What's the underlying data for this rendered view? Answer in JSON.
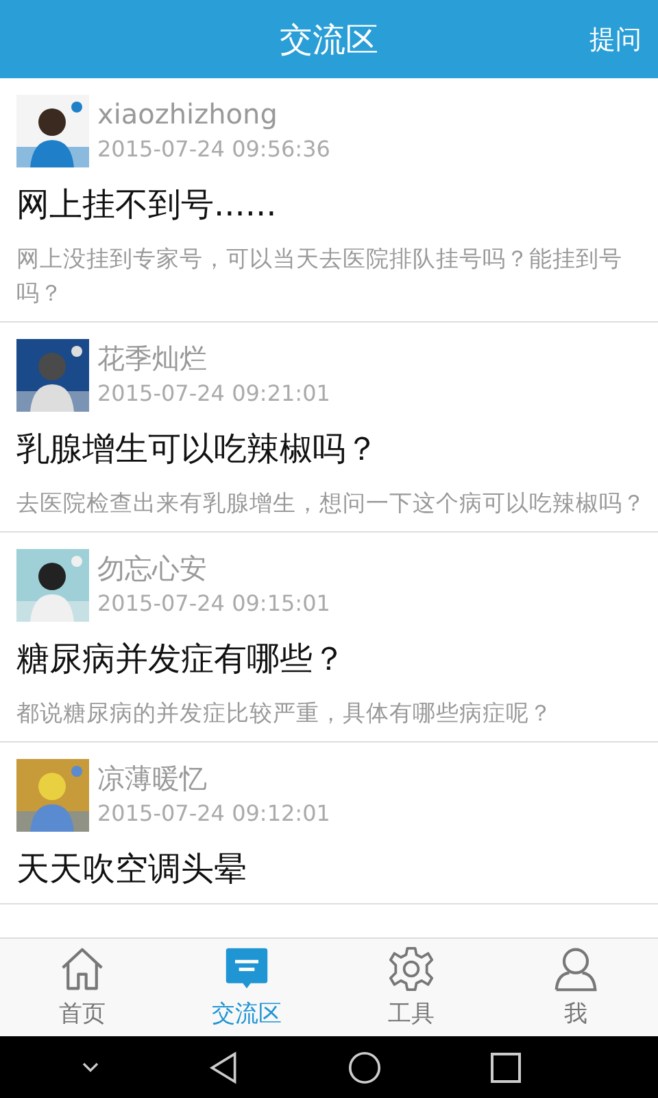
{
  "header": {
    "title": "交流区",
    "action": "提问"
  },
  "posts": [
    {
      "user": "xiaozhizhong",
      "time": "2015-07-24 09:56:36",
      "title": "网上挂不到号......",
      "snippet": "网上没挂到专家号，可以当天去医院排队挂号吗？能挂到号吗？"
    },
    {
      "user": "花季灿烂",
      "time": "2015-07-24 09:21:01",
      "title": "乳腺增生可以吃辣椒吗？",
      "snippet": "去医院检查出来有乳腺增生，想问一下这个病可以吃辣椒吗？"
    },
    {
      "user": "勿忘心安",
      "time": "2015-07-24 09:15:01",
      "title": "糖尿病并发症有哪些？",
      "snippet": "都说糖尿病的并发症比较严重，具体有哪些病症呢？"
    },
    {
      "user": "凉薄暖忆",
      "time": "2015-07-24 09:12:01",
      "title": "天天吹空调头晕"
    }
  ],
  "tabs": [
    {
      "label": "首页",
      "kind": "home",
      "selected": false
    },
    {
      "label": "交流区",
      "kind": "chat",
      "selected": true
    },
    {
      "label": "工具",
      "kind": "gear",
      "selected": false
    },
    {
      "label": "我",
      "kind": "person",
      "selected": false
    }
  ]
}
